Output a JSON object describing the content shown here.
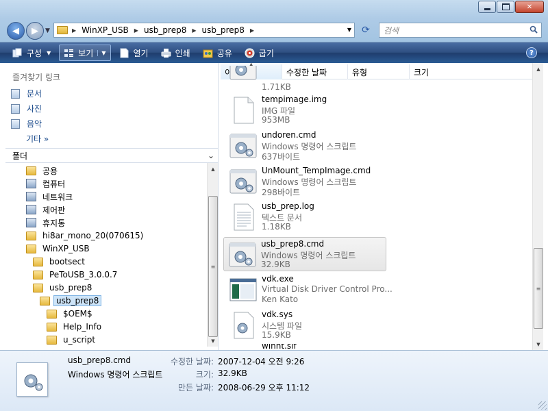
{
  "window": {
    "caption_buttons": {
      "minimize": "minimize",
      "maximize": "maximize",
      "close": "✕"
    }
  },
  "address": {
    "crumbs": [
      "WinXP_USB",
      "usb_prep8",
      "usb_prep8"
    ]
  },
  "search": {
    "placeholder": "검색"
  },
  "commandbar": {
    "organize": "구성",
    "views": "보기",
    "open": "열기",
    "print": "인쇄",
    "share": "공유",
    "burn": "굽기",
    "help": "?"
  },
  "favorites": {
    "header": "즐겨찾기 링크",
    "items": [
      {
        "label": "문서",
        "icon": "documents-icon"
      },
      {
        "label": "사진",
        "icon": "pictures-icon"
      },
      {
        "label": "음악",
        "icon": "music-icon"
      }
    ],
    "more": "기타 »"
  },
  "folders": {
    "header": "폴더",
    "tree": [
      {
        "label": "공용",
        "icon": "folder-icon",
        "depth": 0
      },
      {
        "label": "컴퓨터",
        "icon": "computer-icon",
        "depth": 0
      },
      {
        "label": "네트워크",
        "icon": "network-icon",
        "depth": 0
      },
      {
        "label": "제어판",
        "icon": "control-panel-icon",
        "depth": 0
      },
      {
        "label": "휴지통",
        "icon": "recycle-bin-icon",
        "depth": 0
      },
      {
        "label": "hi8ar_mono_20(070615)",
        "icon": "folder-icon",
        "depth": 0
      },
      {
        "label": "WinXP_USB",
        "icon": "folder-icon",
        "depth": 0
      },
      {
        "label": "bootsect",
        "icon": "folder-icon",
        "depth": 1
      },
      {
        "label": "PeToUSB_3.0.0.7",
        "icon": "folder-icon",
        "depth": 1
      },
      {
        "label": "usb_prep8",
        "icon": "folder-icon",
        "depth": 1
      },
      {
        "label": "usb_prep8",
        "icon": "folder-icon",
        "depth": 2,
        "selected": true
      },
      {
        "label": "$OEM$",
        "icon": "folder-icon",
        "depth": 3
      },
      {
        "label": "Help_Info",
        "icon": "folder-icon",
        "depth": 3
      },
      {
        "label": "u_script",
        "icon": "folder-icon",
        "depth": 3
      }
    ]
  },
  "columns": [
    "이름",
    "수정한 날짜",
    "유형",
    "크기"
  ],
  "files": [
    {
      "name": "",
      "type": "",
      "size": "1.71KB",
      "icon": "script-gear-icon",
      "partial": true
    },
    {
      "name": "tempimage.img",
      "type": "IMG 파일",
      "size": "953MB",
      "icon": "blank-file-icon"
    },
    {
      "name": "undoren.cmd",
      "type": "Windows 명령어 스크립트",
      "size": "637바이트",
      "icon": "script-gear-icon"
    },
    {
      "name": "UnMount_TempImage.cmd",
      "type": "Windows 명령어 스크립트",
      "size": "298바이트",
      "icon": "script-gear-icon"
    },
    {
      "name": "usb_prep.log",
      "type": "텍스트 문서",
      "size": "1.18KB",
      "icon": "text-file-icon"
    },
    {
      "name": "usb_prep8.cmd",
      "type": "Windows 명령어 스크립트",
      "size": "32.9KB",
      "icon": "script-gear-icon",
      "selected": true
    },
    {
      "name": "vdk.exe",
      "type": "Virtual Disk Driver Control Pro...",
      "size": "Ken Kato",
      "icon": "exe-window-icon"
    },
    {
      "name": "vdk.sys",
      "type": "시스템 파일",
      "size": "15.9KB",
      "icon": "system-file-icon"
    },
    {
      "name": "winnt.sif",
      "type": "",
      "size": "",
      "icon": "text-file-icon",
      "partial": true
    }
  ],
  "details": {
    "name": "usb_prep8.cmd",
    "type": "Windows 명령어 스크립트",
    "modified_label": "수정한 날짜:",
    "modified_value": "2007-12-04 오전 9:26",
    "size_label": "크기:",
    "size_value": "32.9KB",
    "created_label": "만든 날짜:",
    "created_value": "2008-06-29 오후 11:12"
  }
}
